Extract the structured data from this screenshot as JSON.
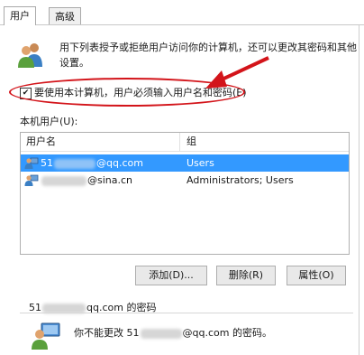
{
  "tabs": [
    {
      "label": "用户"
    },
    {
      "label": "高级"
    }
  ],
  "description": "用下列表授予或拒绝用户访问你的计算机，还可以更改其密码和其他设置。",
  "require_login_checkbox": {
    "label": "要使用本计算机，用户必须输入用户名和密码(E)",
    "checked": true
  },
  "local_users_label": "本机用户(U):",
  "user_table": {
    "columns": [
      "用户名",
      "组"
    ],
    "rows": [
      {
        "name_prefix": "51",
        "name_suffix": "@qq.com",
        "group": "Users",
        "selected": true
      },
      {
        "name_prefix": "",
        "name_suffix": "@sina.cn",
        "group": "Administrators; Users",
        "selected": false
      }
    ]
  },
  "buttons": {
    "add": "添加(D)...",
    "remove": "删除(R)",
    "properties": "属性(O)"
  },
  "password_group": {
    "title_prefix": "51",
    "title_suffix": "qq.com 的密码",
    "message_prefix": "你不能更改 51",
    "message_suffix": "@qq.com 的密码。"
  },
  "colors": {
    "selection": "#3399ff",
    "annotation": "#d3141a"
  },
  "icons": [
    "users-icon",
    "user-icon",
    "password-user-icon",
    "check-icon",
    "annotation-arrow"
  ]
}
